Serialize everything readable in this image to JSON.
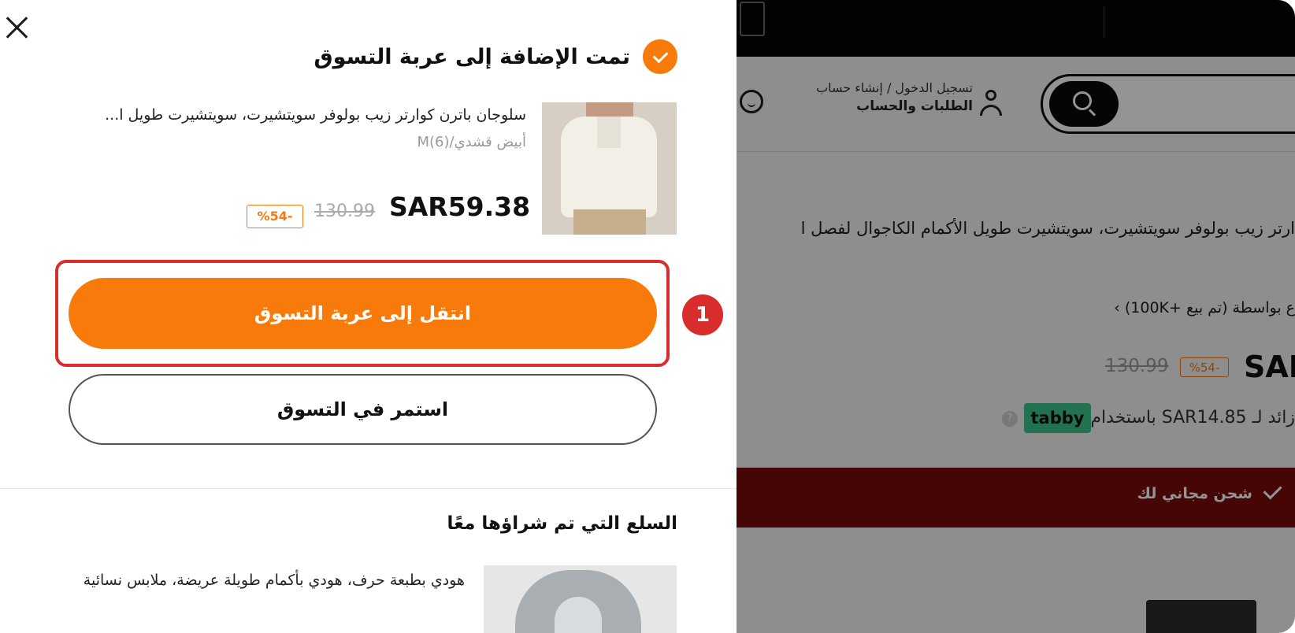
{
  "drawer": {
    "close_icon": "close-icon",
    "added_title": "تمت الإضافة إلى عربة التسوق",
    "product": {
      "name": "سلوجان باترن كوارتر زيب بولوفر سويتشيرت، سويتشيرت طويل ا...",
      "variant": "أبيض قشدي/M(6)",
      "price": "SAR59.38",
      "old_price": "130.99",
      "discount": "%54-"
    },
    "go_to_cart_label": "انتقل إلى عربة التسوق",
    "step_number": "1",
    "continue_label": "استمر في التسوق",
    "bought_together_title": "السلع التي تم شراؤها معًا",
    "recommended": {
      "name": "هودي بطبعة حرف، هودي بأكمام طويلة عريضة، ملابس نسائية"
    }
  },
  "background": {
    "account_line1": "تسجيل الدخول / إنشاء حساب",
    "account_line2": "الطلبات والحساب",
    "product_title": "ارتر زيب بولوفر سويتشيرت، سويتشيرت طويل الأكمام الكاجوال لفصل ا",
    "seller_line": "ع بواسطة  (تم بيع +100K) ›",
    "price": "SAR",
    "old_price": "130.99",
    "discount": "%54-",
    "installment": "زائد لـ SAR14.85 باستخدام",
    "tabby_label": "tabby",
    "shipping": "شحن مجاني لك"
  },
  "colors": {
    "accent_orange": "#f77a0a",
    "highlight_red": "#d92c2c",
    "shipping_banner": "#7a0c0c",
    "tabby_green": "#3bc48c"
  }
}
